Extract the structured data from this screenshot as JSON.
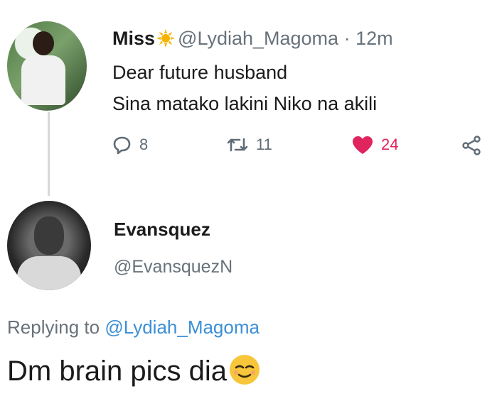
{
  "original_tweet": {
    "display_name": "Miss",
    "handle": "@Lydiah_Magoma",
    "separator": "·",
    "time": "12m",
    "lines": [
      "Dear future husband",
      "Sina matako lakini Niko na akili"
    ],
    "actions": {
      "replies": "8",
      "retweets": "11",
      "likes": "24"
    }
  },
  "reply_tweet": {
    "display_name": "Evansquez",
    "handle": "@EvansquezN",
    "replying_prefix": "Replying to",
    "replying_handle": "@Lydiah_Magoma",
    "text": "Dm brain pics dia"
  },
  "colors": {
    "like": "#e0245e",
    "link": "#3b8fd6",
    "muted": "#68727b"
  },
  "icons": [
    "sun-emoji-icon",
    "reply-icon",
    "retweet-icon",
    "heart-icon",
    "share-icon",
    "relieved-face-emoji-icon"
  ]
}
